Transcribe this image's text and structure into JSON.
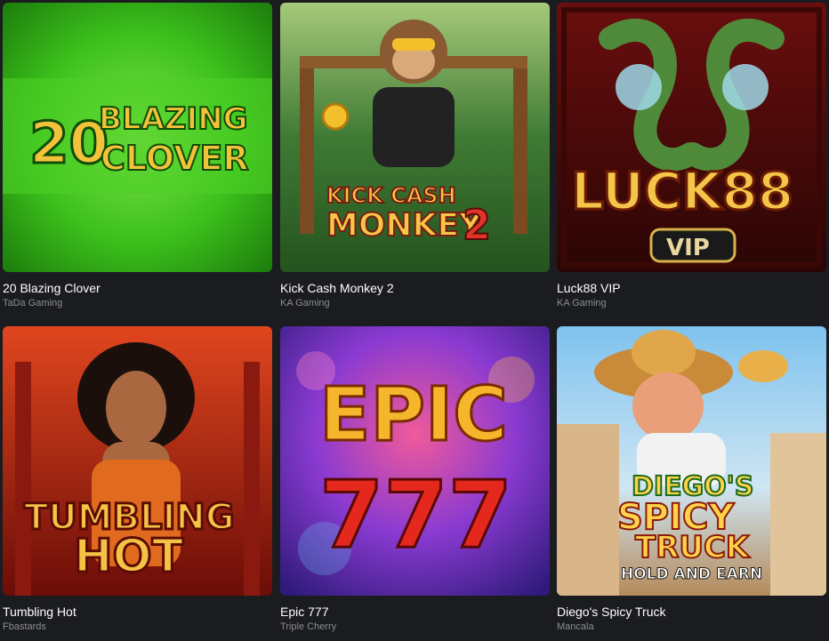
{
  "games": [
    {
      "title": "20 Blazing Clover",
      "provider": "TaDa Gaming",
      "logo_top": "BLAZING",
      "logo_num": "20",
      "logo_bottom": "CLOVER",
      "accent": "#3bbf1e"
    },
    {
      "title": "Kick Cash Monkey 2",
      "provider": "KA Gaming",
      "logo_top": "KICK CASH",
      "logo_bottom": "MONKEY",
      "logo_num": "2",
      "accent": "#2f6b2a"
    },
    {
      "title": "Luck88 VIP",
      "provider": "KA Gaming",
      "logo_main": "LUCK88",
      "logo_badge": "VIP",
      "accent": "#8a1414"
    },
    {
      "title": "Tumbling Hot",
      "provider": "Fbastards",
      "logo_top": "TUMBLING",
      "logo_bottom": "HOT",
      "accent": "#b8261a"
    },
    {
      "title": "Epic 777",
      "provider": "Triple Cherry",
      "logo_top": "EPIC",
      "logo_bottom": "777",
      "accent": "#7a2bd1"
    },
    {
      "title": "Diego's Spicy Truck",
      "provider": "Mancala",
      "logo_top": "DIEGO'S",
      "logo_mid": "SPICY",
      "logo_bottom": "TRUCK",
      "logo_sub": "HOLD AND EARN",
      "accent": "#6fb3e0"
    }
  ]
}
